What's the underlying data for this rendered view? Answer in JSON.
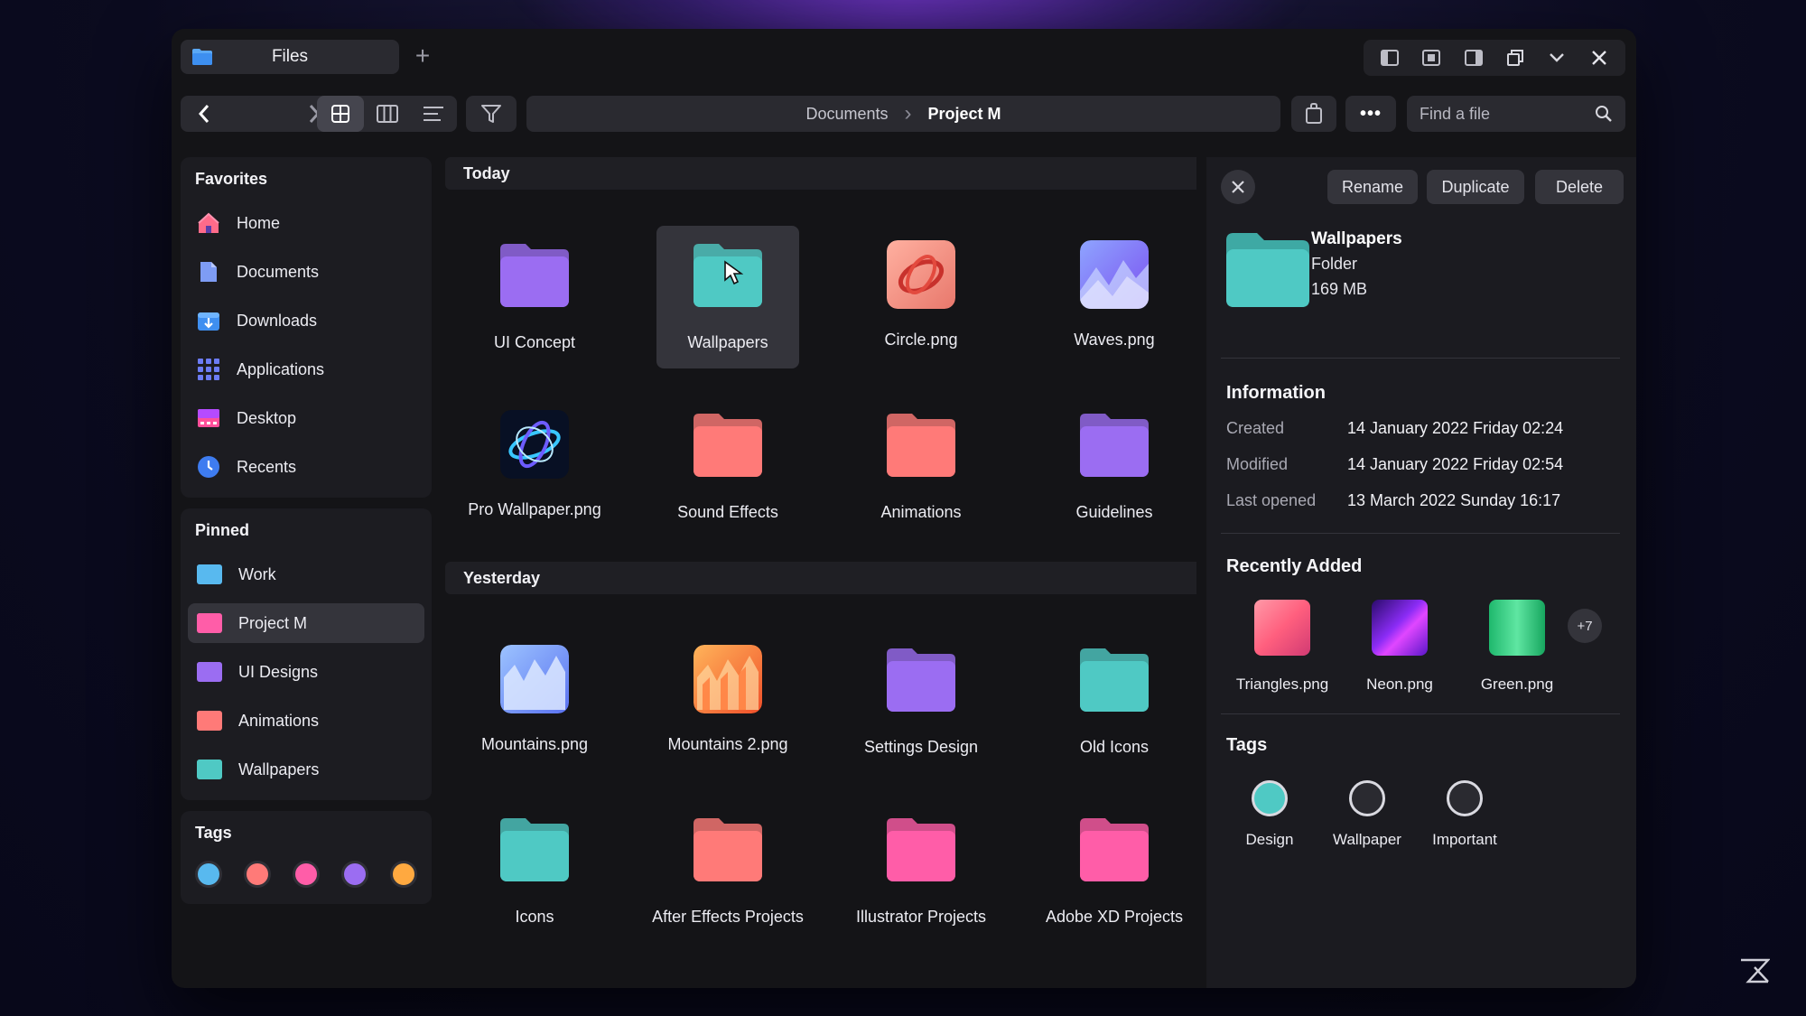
{
  "colors": {
    "teal": "#4fc9c4",
    "purple": "#9b6df2",
    "coral": "#ff7a78",
    "pink": "#ff5da8",
    "blue": "#58b9ef"
  },
  "tab": {
    "title": "Files",
    "new_tab": "+"
  },
  "breadcrumb": {
    "parent": "Documents",
    "separator": "›",
    "current": "Project M"
  },
  "search": {
    "placeholder": "Find a file"
  },
  "toolbar": {
    "more_label": "•••"
  },
  "sidebar": {
    "favorites_title": "Favorites",
    "favorites": [
      {
        "label": "Home",
        "icon": "home-icon"
      },
      {
        "label": "Documents",
        "icon": "document-icon"
      },
      {
        "label": "Downloads",
        "icon": "download-icon"
      },
      {
        "label": "Applications",
        "icon": "applications-icon"
      },
      {
        "label": "Desktop",
        "icon": "desktop-icon"
      },
      {
        "label": "Recents",
        "icon": "clock-icon"
      }
    ],
    "pinned_title": "Pinned",
    "pinned": [
      {
        "label": "Work",
        "color": "#58b9ef"
      },
      {
        "label": "Project M",
        "color": "#ff5da8",
        "active": true
      },
      {
        "label": "UI Designs",
        "color": "#9b6df2"
      },
      {
        "label": "Animations",
        "color": "#ff7a78"
      },
      {
        "label": "Wallpapers",
        "color": "#4fc9c4"
      }
    ],
    "tags_title": "Tags",
    "tag_colors": [
      "#58b9ef",
      "#ff7a78",
      "#ff5da8",
      "#9b6df2",
      "#ffa940"
    ]
  },
  "sections": [
    {
      "title": "Today",
      "files": [
        {
          "name": "UI Concept",
          "kind": "folder",
          "color": "#9b6df2"
        },
        {
          "name": "Wallpapers",
          "kind": "folder",
          "color": "#4fc9c4",
          "selected": true
        },
        {
          "name": "Circle.png",
          "kind": "image",
          "art": "circle"
        },
        {
          "name": "Waves.png",
          "kind": "image",
          "art": "waves"
        },
        {
          "name": "Pro Wallpaper.png",
          "kind": "image",
          "art": "pro"
        },
        {
          "name": "Sound Effects",
          "kind": "folder",
          "color": "#ff7a78"
        },
        {
          "name": "Animations",
          "kind": "folder",
          "color": "#ff7a78"
        },
        {
          "name": "Guidelines",
          "kind": "folder",
          "color": "#9b6df2"
        }
      ]
    },
    {
      "title": "Yesterday",
      "files": [
        {
          "name": "Mountains.png",
          "kind": "image",
          "art": "mountains"
        },
        {
          "name": "Mountains 2.png",
          "kind": "image",
          "art": "mountains2"
        },
        {
          "name": "Settings Design",
          "kind": "folder",
          "color": "#9b6df2"
        },
        {
          "name": "Old Icons",
          "kind": "folder",
          "color": "#4fc9c4"
        },
        {
          "name": "Icons",
          "kind": "folder",
          "color": "#4fc9c4"
        },
        {
          "name": "After Effects Projects",
          "kind": "folder",
          "color": "#ff7a78"
        },
        {
          "name": "Illustrator Projects",
          "kind": "folder",
          "color": "#ff5da8"
        },
        {
          "name": "Adobe XD Projects",
          "kind": "folder",
          "color": "#ff5da8"
        }
      ]
    }
  ],
  "details": {
    "actions": {
      "rename": "Rename",
      "duplicate": "Duplicate",
      "delete": "Delete"
    },
    "selected": {
      "name": "Wallpapers",
      "kind": "Folder",
      "size": "169 MB"
    },
    "information_title": "Information",
    "info": [
      {
        "label": "Created",
        "value": "14 January 2022 Friday 02:24"
      },
      {
        "label": "Modified",
        "value": "14 January 2022 Friday 02:54"
      },
      {
        "label": "Last opened",
        "value": "13 March 2022 Sunday 16:17"
      }
    ],
    "recent_title": "Recently Added",
    "recent": [
      {
        "name": "Triangles.png",
        "art": "triangles"
      },
      {
        "name": "Neon.png",
        "art": "neon"
      },
      {
        "name": "Green.png",
        "art": "green"
      }
    ],
    "recent_more": "+7",
    "tags_title": "Tags",
    "tags": [
      {
        "name": "Design",
        "color": "#4fc9c4",
        "filled": true
      },
      {
        "name": "Wallpaper",
        "color": "#2a2a30",
        "filled": false
      },
      {
        "name": "Important",
        "color": "#2a2a30",
        "filled": false
      }
    ]
  }
}
